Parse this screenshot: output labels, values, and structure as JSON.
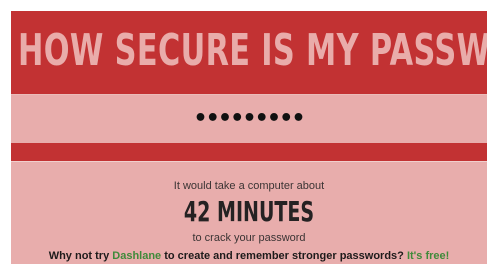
{
  "header": {
    "title": "HOW SECURE IS MY PASSWORD?"
  },
  "password": {
    "masked_value": "•••••••••"
  },
  "result": {
    "intro": "It would take a computer about",
    "time": "42 MINUTES",
    "suffix": "to crack your password"
  },
  "cta": {
    "prefix": "Why not try ",
    "link_label": "Dashlane",
    "middle": " to create and remember stronger passwords? ",
    "free_label": "It's free!"
  },
  "colors": {
    "header_bg": "#c23233",
    "header_text": "#e9acaa",
    "panel_bg": "#e8adac",
    "link_green": "#3f8a3a"
  }
}
